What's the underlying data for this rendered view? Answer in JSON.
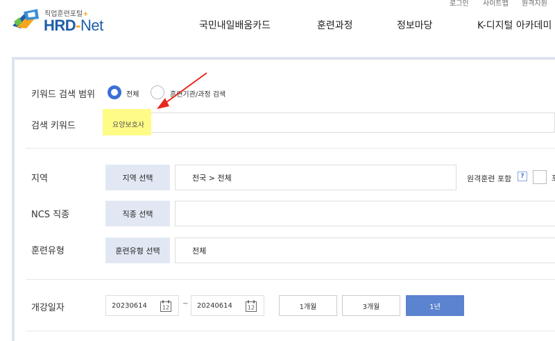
{
  "header": {
    "util": [
      "로그인",
      "사이트맵",
      "원격지원"
    ],
    "logo": {
      "subtitle": "직업훈련포털",
      "plus": "+",
      "name_a": "HRD",
      "dash": "-",
      "name_b": "Net"
    },
    "nav": [
      "국민내일배움카드",
      "훈련과정",
      "정보마당",
      "K-디지털 아카데미"
    ]
  },
  "search": {
    "scope_label": "키워드 검색 범위",
    "scope_options": [
      "전체",
      "훈련기관/과정 검색"
    ],
    "keyword_label": "검색 키워드",
    "keyword_value": "요양보호사",
    "region_label": "지역",
    "region_button": "지역 선택",
    "region_value": "전국 > 전체",
    "remote_label": "원격훈련 포함",
    "help_mark": "?",
    "remote_cut": "포",
    "ncs_label": "NCS 직종",
    "ncs_button": "직종 선택",
    "ncs_value": "",
    "type_label": "훈련유형",
    "type_button": "훈련유형 선택",
    "type_value": "전체",
    "date_label": "개강일자",
    "date_start": "20230614",
    "date_sep": "~",
    "date_end": "20240614",
    "cal_day": "12",
    "periods": [
      "1개월",
      "3개월",
      "1년"
    ],
    "active_period": "1년"
  },
  "colors": {
    "accent": "#3b6fd8",
    "highlight": "#fffb87",
    "arrow": "#e8281f",
    "button_bg": "#e1e8f4",
    "active_btn": "#5b83cf"
  }
}
